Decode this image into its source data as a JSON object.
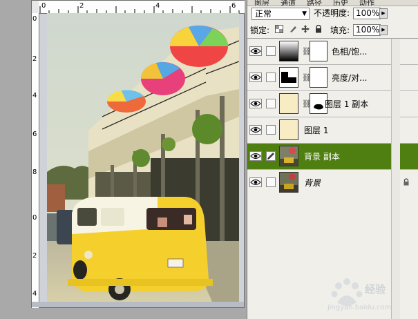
{
  "document": {
    "ruler_top_numbers": [
      "0",
      "2",
      "4",
      "6"
    ],
    "ruler_left_numbers": [
      "0",
      "2",
      "4",
      "6",
      "8",
      "0",
      "2",
      "4"
    ]
  },
  "panel": {
    "tabs": [
      "图层",
      "通道",
      "路径",
      "历史",
      "动作"
    ],
    "blend_mode": "正常",
    "opacity_label": "不透明度:",
    "opacity_value": "100%",
    "lock_label": "锁定:",
    "fill_label": "填充:",
    "fill_value": "100%",
    "layers": [
      {
        "name": "色相/饱...",
        "type": "adjustment",
        "visible": true,
        "selected": false
      },
      {
        "name": "亮度/对...",
        "type": "adjustment",
        "visible": true,
        "selected": false
      },
      {
        "name": "图层 1 副本",
        "type": "pixel-with-mask",
        "visible": true,
        "selected": false
      },
      {
        "name": "图层 1",
        "type": "pixel",
        "visible": true,
        "selected": false
      },
      {
        "name": "背景 副本",
        "type": "pixel",
        "visible": true,
        "selected": true
      },
      {
        "name": "背景",
        "type": "background",
        "visible": true,
        "selected": false,
        "locked": true
      }
    ]
  },
  "watermark": {
    "text": "经验",
    "url": "jingyan.baidu.com"
  },
  "colors": {
    "selected_layer": "#4f7f10",
    "panel_bg": "#f0efe9",
    "cream_fill": "#f7ecc4"
  }
}
